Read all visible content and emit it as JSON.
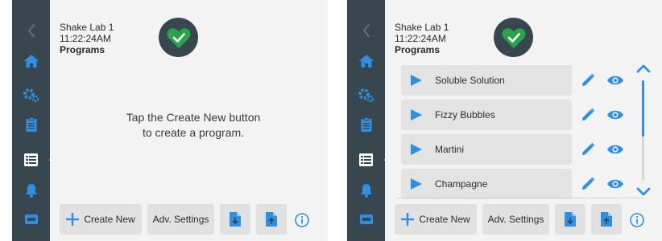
{
  "colors": {
    "sidebar": "#38474f",
    "accent": "#2f8fe3",
    "status_green": "#2aa44b",
    "button_bg": "#e1e1e1",
    "panel_bg": "#f3f3f3"
  },
  "screens": [
    {
      "header": {
        "device_name": "Shake Lab 1",
        "time": "11:22:24AM",
        "page": "Programs"
      },
      "status_icon": "heart-check-icon",
      "empty_message_line1": "Tap the Create New button",
      "empty_message_line2": "to create a program.",
      "toolbar": {
        "create_label": "Create New",
        "adv_label": "Adv. Settings"
      }
    },
    {
      "header": {
        "device_name": "Shake Lab 1",
        "time": "11:22:24AM",
        "page": "Programs"
      },
      "status_icon": "heart-check-icon",
      "programs": [
        "Soluble Solution",
        "Fizzy Bubbles",
        "Martini",
        "Champagne"
      ],
      "toolbar": {
        "create_label": "Create New",
        "adv_label": "Adv. Settings"
      },
      "scroll_position": 0
    }
  ],
  "nav_icons": [
    "back-icon",
    "home-icon",
    "settings-icon",
    "clipboard-icon",
    "programs-icon",
    "alarm-icon",
    "device-icon"
  ]
}
